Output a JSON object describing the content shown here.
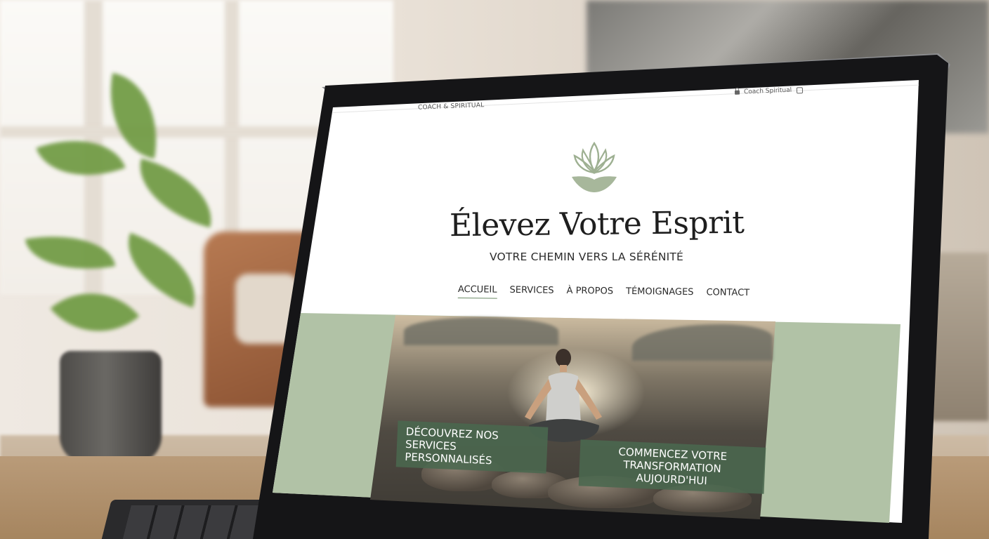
{
  "site": {
    "brand_left": "COACH & SPIRITUAL",
    "brand_right": "Coach Spiritual",
    "title": "Élevez Votre Esprit",
    "subtitle": "VOTRE CHEMIN VERS LA SÉRÉNITÉ",
    "nav": [
      {
        "label": "ACCUEIL",
        "active": true
      },
      {
        "label": "SERVICES",
        "active": false
      },
      {
        "label": "À PROPOS",
        "active": false
      },
      {
        "label": "TÉMOIGNAGES",
        "active": false
      },
      {
        "label": "CONTACT",
        "active": false
      }
    ],
    "cta_left": "DÉCOUVREZ NOS SERVICES PERSONNALISÉS",
    "cta_right": "COMMENCEZ VOTRE TRANSFORMATION AUJOURD'HUI"
  },
  "icons": {
    "logo": "lotus-icon",
    "top_right_left": "lock-icon",
    "top_right_right": "box-icon"
  },
  "colors": {
    "accent_sage": "#b1c2a6",
    "button_green": "#4a684e",
    "title_text": "#1e1e1e"
  }
}
